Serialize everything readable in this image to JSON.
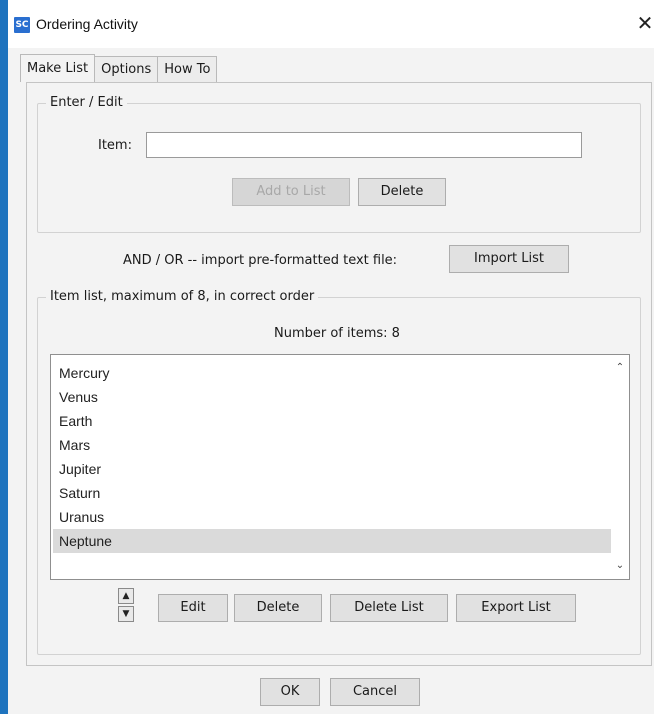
{
  "window": {
    "title": "Ordering Activity",
    "app_icon_text": "SC",
    "close_glyph": "✕"
  },
  "tabs": [
    {
      "label": "Make List",
      "active": true
    },
    {
      "label": "Options",
      "active": false
    },
    {
      "label": "How To",
      "active": false
    }
  ],
  "enter_edit": {
    "group_title": "Enter / Edit",
    "item_label": "Item:",
    "item_value": "",
    "add_label": "Add to List",
    "delete_label": "Delete"
  },
  "import": {
    "text": "AND / OR -- import pre-formatted text file:",
    "button_label": "Import List"
  },
  "item_list": {
    "group_title": "Item list, maximum of 8, in correct order",
    "count_text": "Number of items: 8",
    "items": [
      "Mercury",
      "Venus",
      "Earth",
      "Mars",
      "Jupiter",
      "Saturn",
      "Uranus",
      "Neptune"
    ],
    "selected_item": "Neptune",
    "edit_label": "Edit",
    "delete_label": "Delete",
    "delete_list_label": "Delete List",
    "export_label": "Export List"
  },
  "footer": {
    "ok_label": "OK",
    "cancel_label": "Cancel"
  },
  "icons": {
    "up": "▲",
    "down": "▼",
    "scroll_up": "⌃",
    "scroll_down": "⌄"
  }
}
